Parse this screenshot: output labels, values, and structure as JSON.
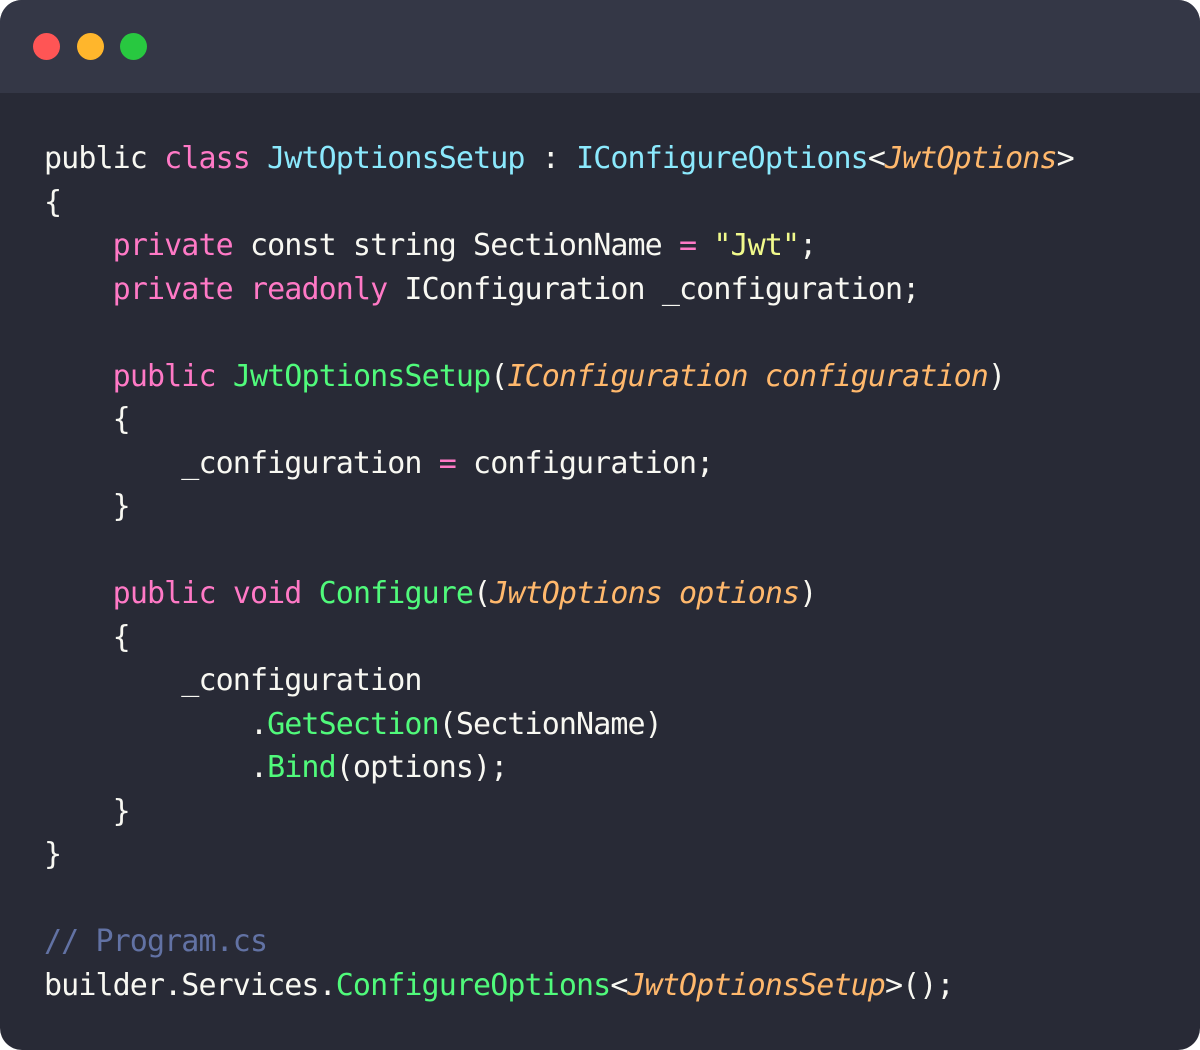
{
  "window": {
    "controls": [
      {
        "name": "close",
        "color": "#ff5555"
      },
      {
        "name": "minimize",
        "color": "#ffb62c"
      },
      {
        "name": "maximize",
        "color": "#28c840"
      }
    ]
  },
  "colors": {
    "background": "#282a36",
    "titlebar": "#343746",
    "text": "#f8f8f2",
    "keyword": "#ff79c6",
    "type": "#8be9fd",
    "function": "#50fa7b",
    "param": "#ffb86c",
    "string": "#f1fa8c",
    "comment": "#6272a4"
  },
  "code": {
    "lines": [
      [
        {
          "t": "public ",
          "c": "text"
        },
        {
          "t": "class",
          "c": "keyword"
        },
        {
          "t": " ",
          "c": "text"
        },
        {
          "t": "JwtOptionsSetup",
          "c": "type"
        },
        {
          "t": " : ",
          "c": "text"
        },
        {
          "t": "IConfigureOptions",
          "c": "type"
        },
        {
          "t": "<",
          "c": "text"
        },
        {
          "t": "JwtOptions",
          "c": "param",
          "i": true
        },
        {
          "t": ">",
          "c": "text"
        }
      ],
      [
        {
          "t": "{",
          "c": "text"
        }
      ],
      [
        {
          "t": "    ",
          "c": "text"
        },
        {
          "t": "private",
          "c": "keyword"
        },
        {
          "t": " const string SectionName ",
          "c": "text"
        },
        {
          "t": "=",
          "c": "keyword"
        },
        {
          "t": " ",
          "c": "text"
        },
        {
          "t": "\"Jwt\"",
          "c": "string"
        },
        {
          "t": ";",
          "c": "text"
        }
      ],
      [
        {
          "t": "    ",
          "c": "text"
        },
        {
          "t": "private",
          "c": "keyword"
        },
        {
          "t": " ",
          "c": "text"
        },
        {
          "t": "readonly",
          "c": "keyword"
        },
        {
          "t": " IConfiguration _configuration;",
          "c": "text"
        }
      ],
      [],
      [
        {
          "t": "    ",
          "c": "text"
        },
        {
          "t": "public",
          "c": "keyword"
        },
        {
          "t": " ",
          "c": "text"
        },
        {
          "t": "JwtOptionsSetup",
          "c": "function"
        },
        {
          "t": "(",
          "c": "text"
        },
        {
          "t": "IConfiguration configuration",
          "c": "param",
          "i": true
        },
        {
          "t": ")",
          "c": "text"
        }
      ],
      [
        {
          "t": "    {",
          "c": "text"
        }
      ],
      [
        {
          "t": "        _configuration ",
          "c": "text"
        },
        {
          "t": "=",
          "c": "keyword"
        },
        {
          "t": " configuration;",
          "c": "text"
        }
      ],
      [
        {
          "t": "    }",
          "c": "text"
        }
      ],
      [],
      [
        {
          "t": "    ",
          "c": "text"
        },
        {
          "t": "public",
          "c": "keyword"
        },
        {
          "t": " ",
          "c": "text"
        },
        {
          "t": "void",
          "c": "keyword"
        },
        {
          "t": " ",
          "c": "text"
        },
        {
          "t": "Configure",
          "c": "function"
        },
        {
          "t": "(",
          "c": "text"
        },
        {
          "t": "JwtOptions options",
          "c": "param",
          "i": true
        },
        {
          "t": ")",
          "c": "text"
        }
      ],
      [
        {
          "t": "    {",
          "c": "text"
        }
      ],
      [
        {
          "t": "        _configuration",
          "c": "text"
        }
      ],
      [
        {
          "t": "            .",
          "c": "text"
        },
        {
          "t": "GetSection",
          "c": "function"
        },
        {
          "t": "(SectionName)",
          "c": "text"
        }
      ],
      [
        {
          "t": "            .",
          "c": "text"
        },
        {
          "t": "Bind",
          "c": "function"
        },
        {
          "t": "(options);",
          "c": "text"
        }
      ],
      [
        {
          "t": "    }",
          "c": "text"
        }
      ],
      [
        {
          "t": "}",
          "c": "text"
        }
      ],
      [],
      [
        {
          "t": "// Program.cs",
          "c": "comment"
        }
      ],
      [
        {
          "t": "builder.Services.",
          "c": "text"
        },
        {
          "t": "ConfigureOptions",
          "c": "function"
        },
        {
          "t": "<",
          "c": "text"
        },
        {
          "t": "JwtOptionsSetup",
          "c": "param",
          "i": true
        },
        {
          "t": ">();",
          "c": "text"
        }
      ]
    ]
  }
}
